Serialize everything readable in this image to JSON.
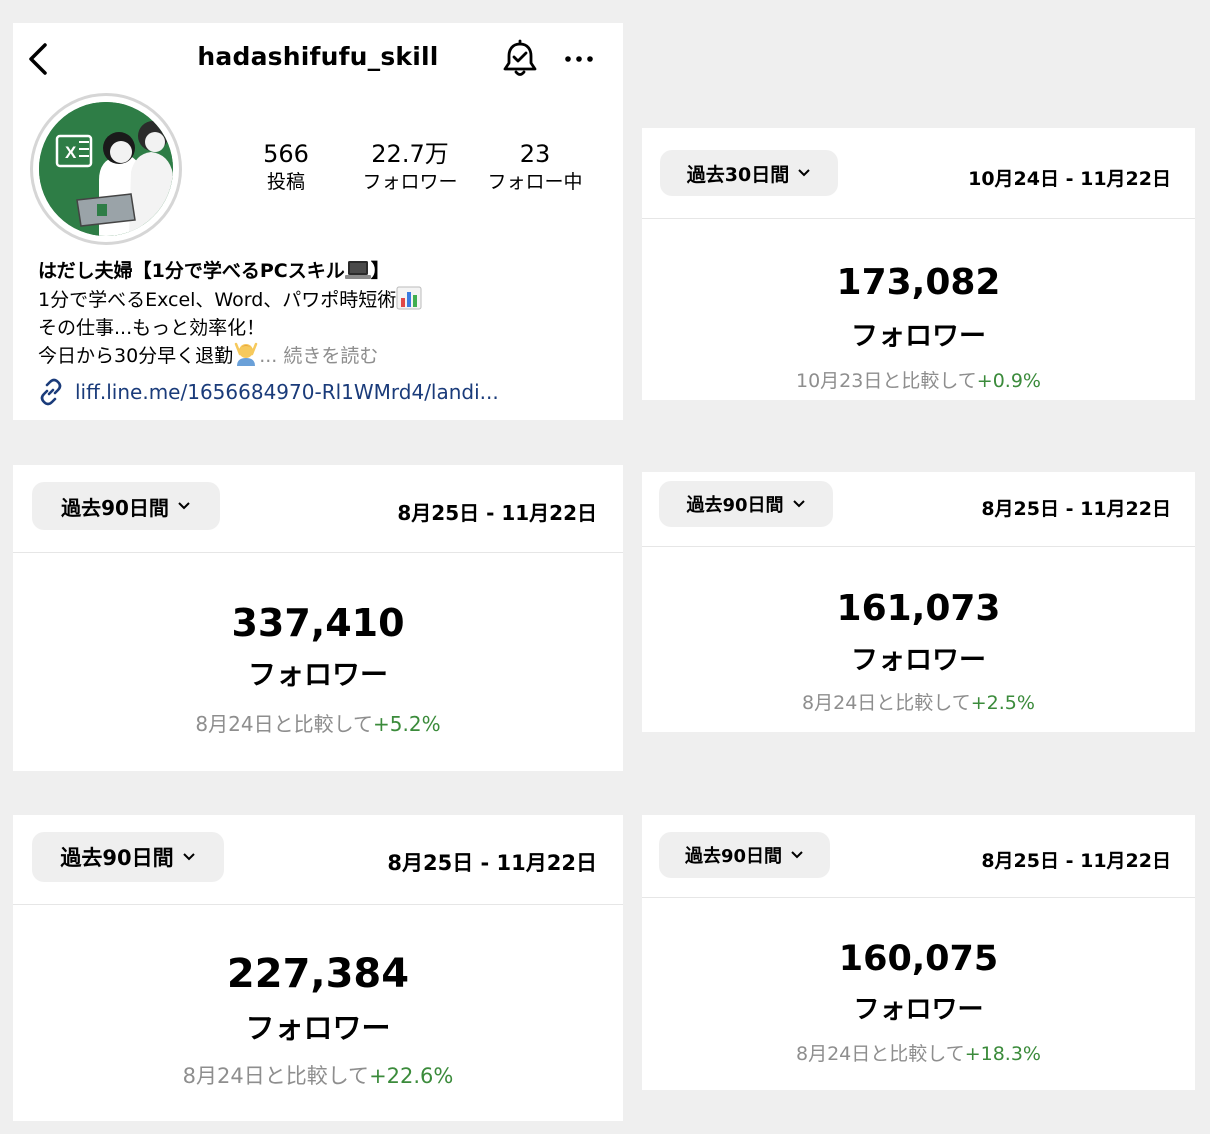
{
  "profile": {
    "username": "hadashifufu_skill",
    "stats": [
      {
        "value": "566",
        "label": "投稿"
      },
      {
        "value": "22.7万",
        "label": "フォロワー"
      },
      {
        "value": "23",
        "label": "フォロー中"
      }
    ],
    "bio_title": "はだし夫婦【1分で学べるPCスキル",
    "bio_title_end": "】",
    "bio_line1": "1分で学べるExcel、Word、パワポ時短術",
    "bio_line2": "その仕事...もっと効率化！",
    "bio_line3": "今日から30分早く退勤",
    "bio_more": "... 続きを読む",
    "link_text": "liff.line.me/1656684970-Rl1WMrd4/landi...",
    "icons": {
      "back": "chevron-left-icon",
      "bell": "bell-check-icon",
      "more": "more-horizontal-icon",
      "link": "link-icon",
      "laptop_emoji": "laptop-emoji",
      "chart_emoji": "bar-chart-emoji",
      "person_emoji": "person-gesturing-emoji"
    }
  },
  "cards": [
    {
      "range_label": "過去30日間",
      "date_range": "10月24日 - 11月22日",
      "followers": "173,082",
      "followers_label": "フォロワー",
      "compare_text": "10月23日と比較して",
      "change": "+0.9%"
    },
    {
      "range_label": "過去90日間",
      "date_range": "8月25日 - 11月22日",
      "followers": "337,410",
      "followers_label": "フォロワー",
      "compare_text": "8月24日と比較して",
      "change": "+5.2%"
    },
    {
      "range_label": "過去90日間",
      "date_range": "8月25日 - 11月22日",
      "followers": "161,073",
      "followers_label": "フォロワー",
      "compare_text": "8月24日と比較して",
      "change": "+2.5%"
    },
    {
      "range_label": "過去90日間",
      "date_range": "8月25日 - 11月22日",
      "followers": "227,384",
      "followers_label": "フォロワー",
      "compare_text": "8月24日と比較して",
      "change": "+22.6%"
    },
    {
      "range_label": "過去90日間",
      "date_range": "8月25日 - 11月22日",
      "followers": "160,075",
      "followers_label": "フォロワー",
      "compare_text": "8月24日と比較して",
      "change": "+18.3%"
    }
  ],
  "colors": {
    "positive": "#3b8b3b",
    "muted": "#8e8e8e",
    "link": "#1a3b7a",
    "avatar_green": "#2e7d46"
  }
}
